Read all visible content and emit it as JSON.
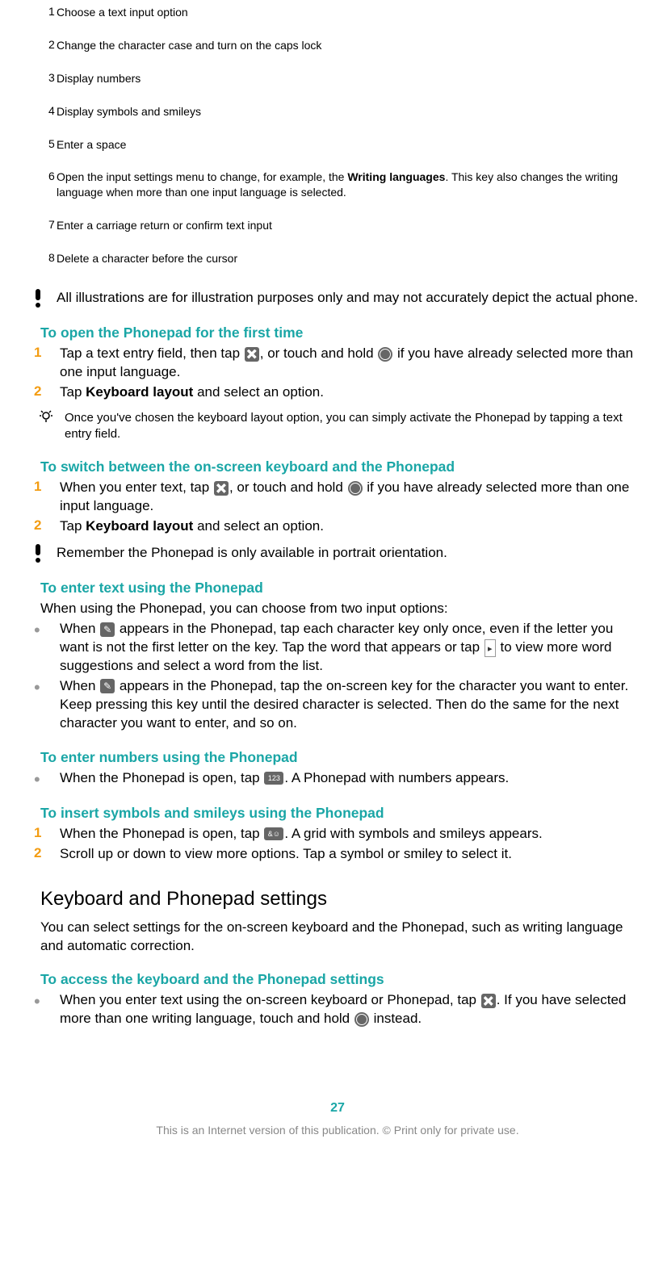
{
  "table": {
    "rows": [
      {
        "n": "1",
        "t": "Choose a text input option"
      },
      {
        "n": "2",
        "t": "Change the character case and turn on the caps lock"
      },
      {
        "n": "3",
        "t": "Display numbers"
      },
      {
        "n": "4",
        "t": "Display symbols and smileys"
      },
      {
        "n": "5",
        "t": "Enter a space"
      },
      {
        "n": "6",
        "t_before": "Open the input settings menu to change, for example, the ",
        "t_bold": "Writing languages",
        "t_after": ". This key also changes the writing language when more than one input language is selected."
      },
      {
        "n": "7",
        "t": "Enter a carriage return or confirm text input"
      },
      {
        "n": "8",
        "t": "Delete a character before the cursor"
      }
    ]
  },
  "note1": "All illustrations are for illustration purposes only and may not accurately depict the actual phone.",
  "sect1": {
    "title": "To open the Phonepad for the first time",
    "s1_a": "Tap a text entry field, then tap ",
    "s1_b": ", or touch and hold ",
    "s1_c": " if you have already selected more than one input language.",
    "s2_a": "Tap ",
    "s2_bold": "Keyboard layout",
    "s2_b": " and select an option."
  },
  "tip1": "Once you've chosen the keyboard layout option, you can simply activate the Phonepad by tapping a text entry field.",
  "sect2": {
    "title": "To switch between the on-screen keyboard and the Phonepad",
    "s1_a": "When you enter text, tap ",
    "s1_b": ", or touch and hold ",
    "s1_c": " if you have already selected more than one input language.",
    "s2_a": "Tap ",
    "s2_bold": "Keyboard layout",
    "s2_b": " and select an option."
  },
  "note2": "Remember the Phonepad is only available in portrait orientation.",
  "sect3": {
    "title": "To enter text using the Phonepad",
    "intro": "When using the Phonepad, you can choose from two input options:",
    "b1_a": "When ",
    "b1_b": " appears in the Phonepad, tap each character key only once, even if the letter you want is not the first letter on the key. Tap the word that appears or tap ",
    "b1_c": " to view more word suggestions and select a word from the list.",
    "b2_a": "When ",
    "b2_b": " appears in the Phonepad, tap the on-screen key for the character you want to enter. Keep pressing this key until the desired character is selected. Then do the same for the next character you want to enter, and so on."
  },
  "sect4": {
    "title": "To enter numbers using the Phonepad",
    "b1_a": "When the Phonepad is open, tap ",
    "b1_b": ". A Phonepad with numbers appears.",
    "icon_123": "123"
  },
  "sect5": {
    "title": "To insert symbols and smileys using the Phonepad",
    "s1_a": "When the Phonepad is open, tap ",
    "s1_b": ". A grid with symbols and smileys appears.",
    "s2": "Scroll up or down to view more options. Tap a symbol or smiley to select it.",
    "icon_sym": "&☺"
  },
  "h2": {
    "title": "Keyboard and Phonepad settings",
    "body": "You can select settings for the on-screen keyboard and the Phonepad, such as writing language and automatic correction."
  },
  "sect6": {
    "title": "To access the keyboard and the Phonepad settings",
    "b1_a": "When you enter text using the on-screen keyboard or Phonepad, tap ",
    "b1_b": ". If you have selected more than one writing language, touch and hold ",
    "b1_c": " instead."
  },
  "page_number": "27",
  "footer": "This is an Internet version of this publication. © Print only for private use.",
  "arrow_glyph": "▸"
}
